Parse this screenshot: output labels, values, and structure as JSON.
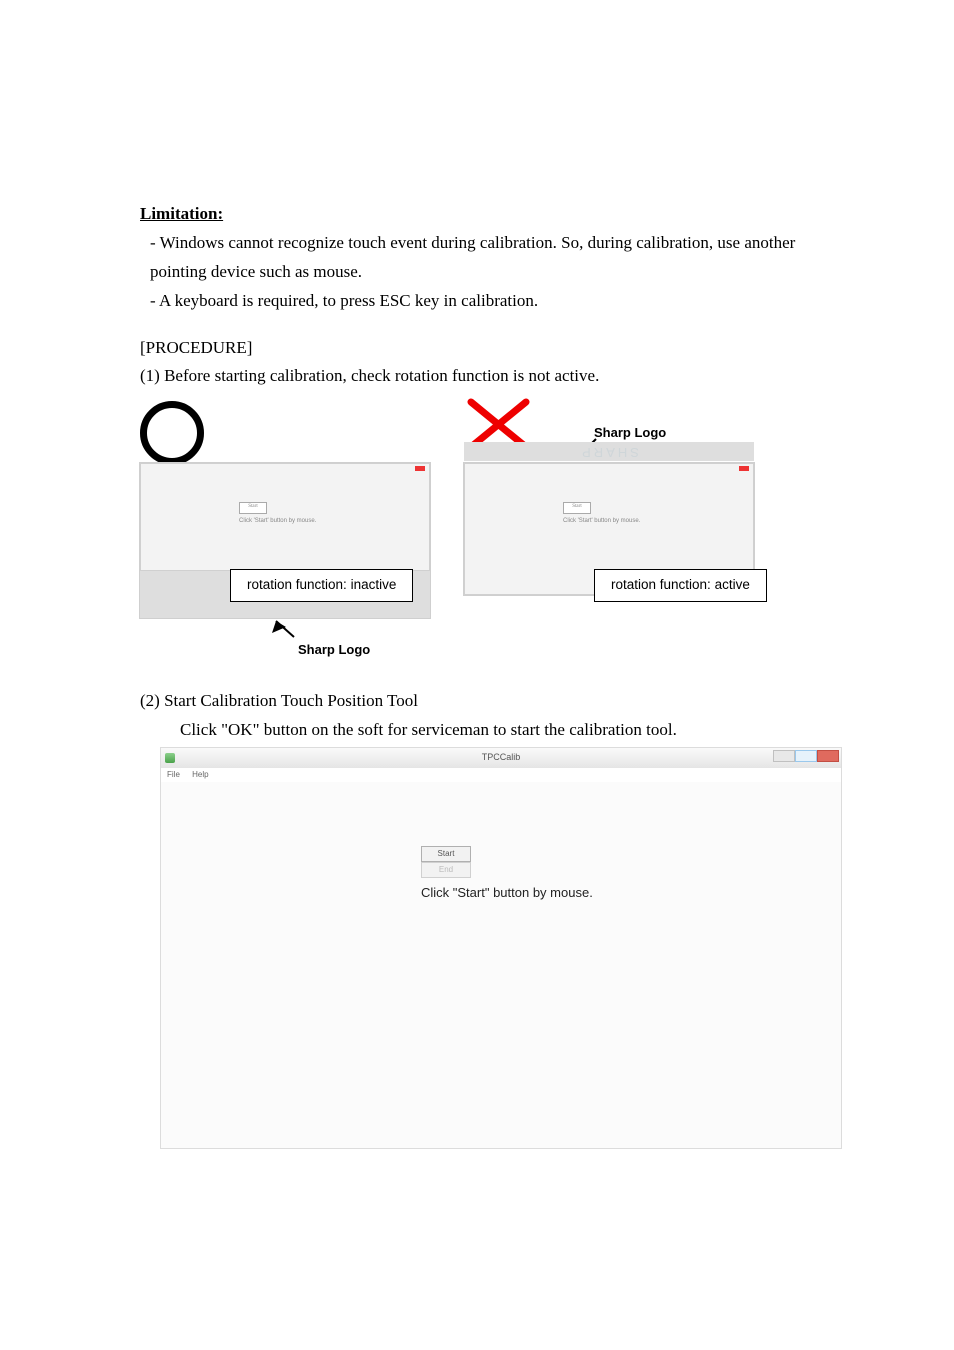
{
  "heading_limitation": "Limitation:",
  "limitation_items": [
    "Windows cannot recognize touch event during calibration. So, during calibration, use another pointing device such as mouse.",
    "A keyboard is required, to press ESC key in calibration."
  ],
  "heading_procedure": "[PROCEDURE]",
  "step1": "(1) Before starting calibration, check rotation function is not active.",
  "sharp_logo_label": "Sharp Logo",
  "rotation_inactive": "rotation function: inactive",
  "rotation_active": "rotation function: active",
  "mini_caption": "Click 'Start' button by mouse.",
  "mini_btn_label": "Start",
  "sharp_wordmark": "SHARP",
  "step2_title": "(2) Start Calibration Touch Position Tool",
  "step2_body": "Click \"OK\" button on the soft for serviceman to start the calibration tool.",
  "tpc_title": "TPCCalib",
  "tpc_menu_file": "File",
  "tpc_menu_help": "Help",
  "tpc_btn_start": "Start",
  "tpc_btn_end": "End",
  "tpc_big_text": "Click \"Start\" button by mouse."
}
